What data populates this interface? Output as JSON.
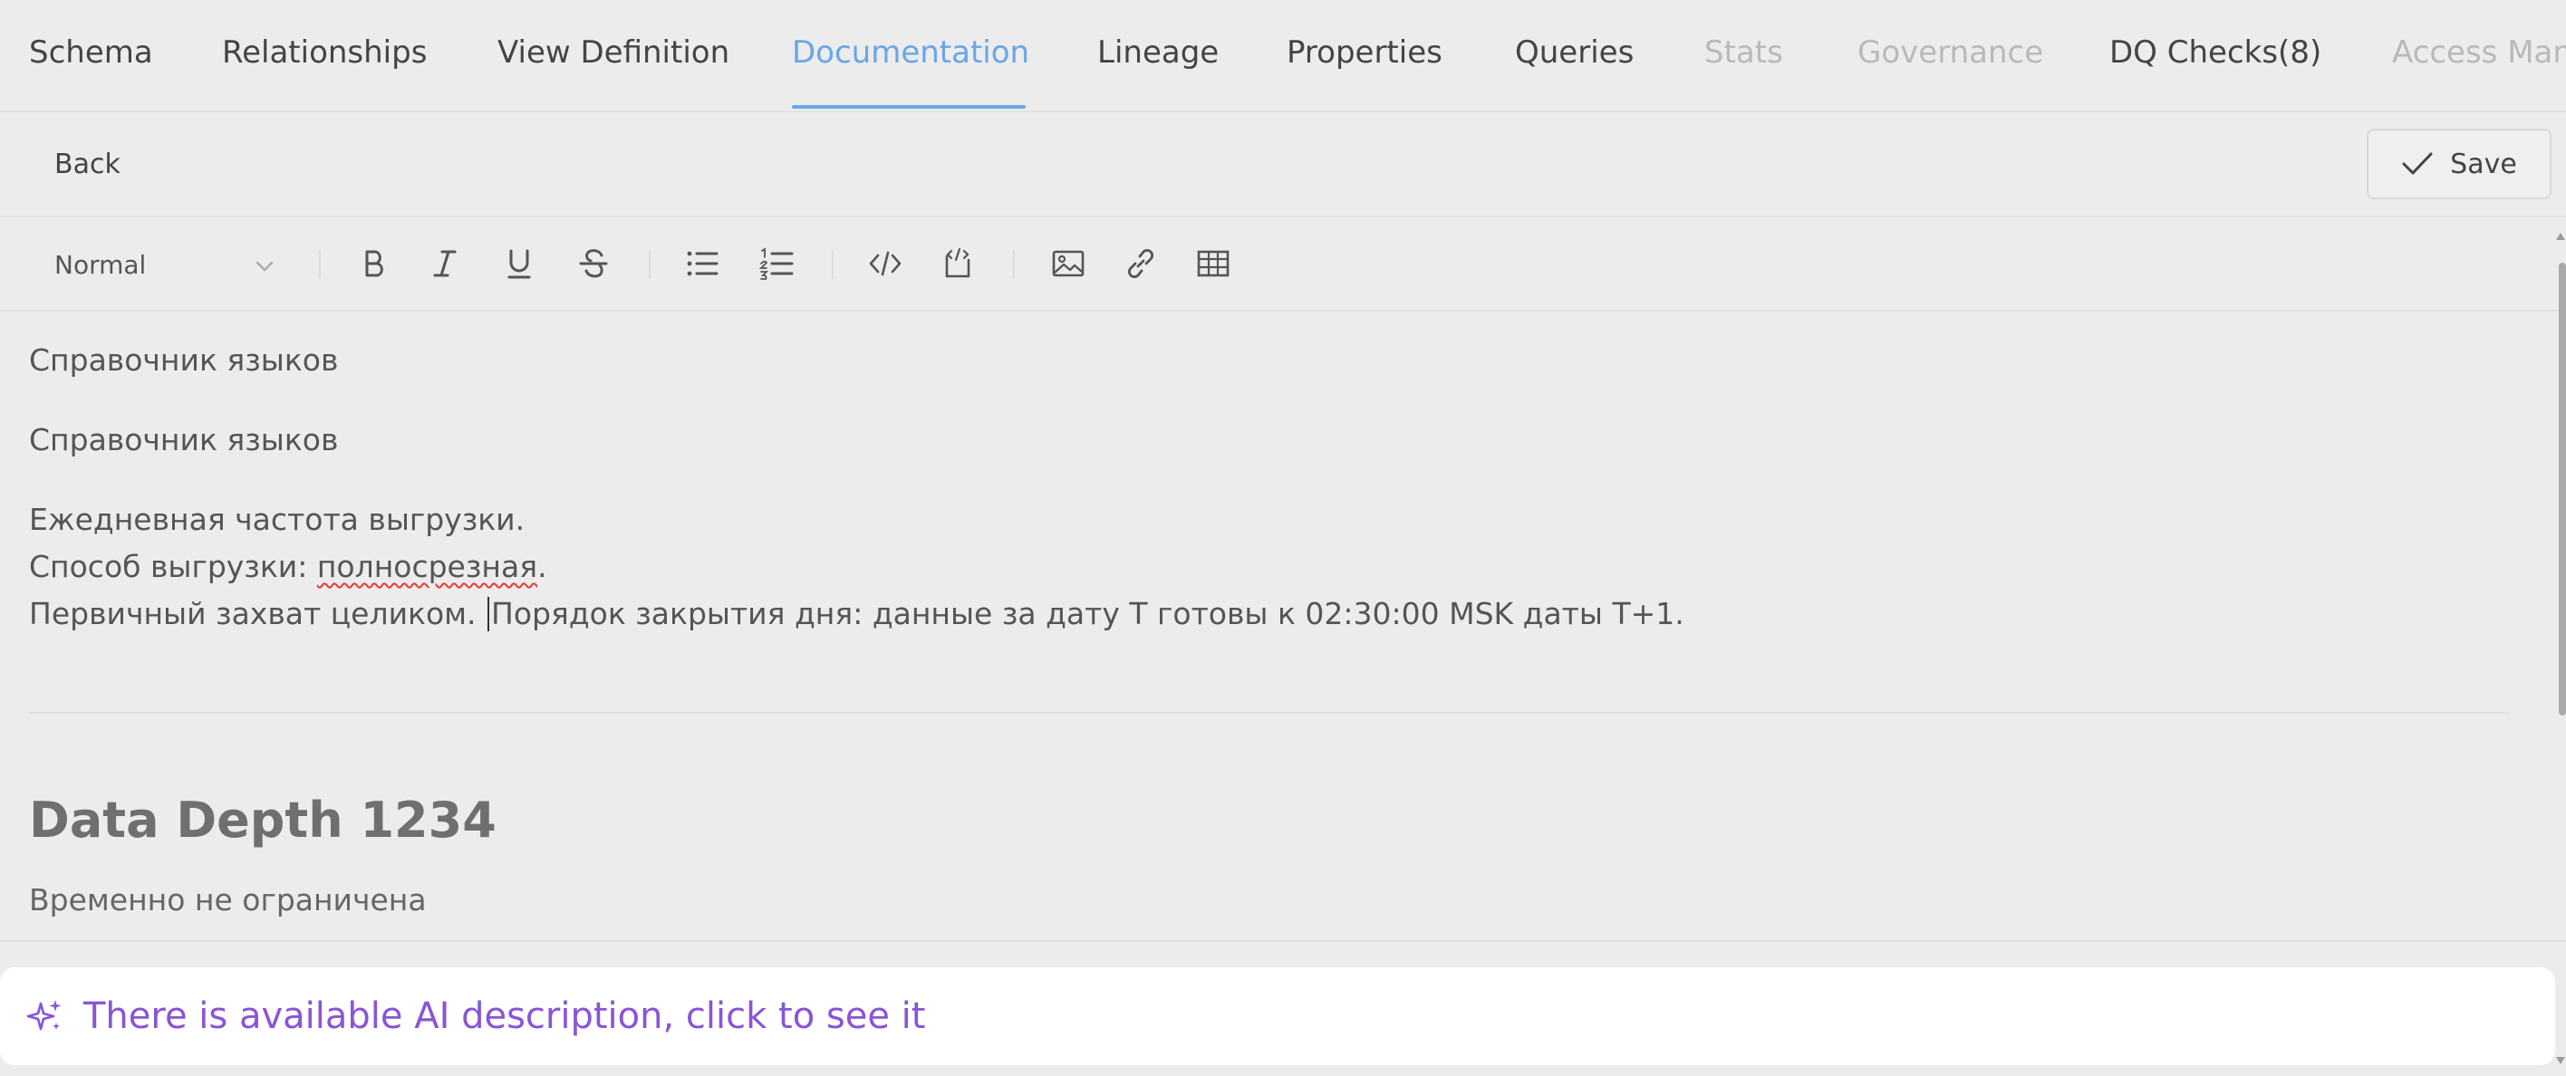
{
  "tabs": [
    {
      "label": "Schema"
    },
    {
      "label": "Relationships"
    },
    {
      "label": "View Definition"
    },
    {
      "label": "Documentation"
    },
    {
      "label": "Lineage"
    },
    {
      "label": "Properties"
    },
    {
      "label": "Queries"
    },
    {
      "label": "Stats"
    },
    {
      "label": "Governance"
    },
    {
      "label": "DQ Checks(8)"
    },
    {
      "label": "Access Man"
    }
  ],
  "actionbar": {
    "back_label": "Back",
    "save_label": "Save"
  },
  "toolbar": {
    "format_value": "Normal",
    "icons": [
      "bold-icon",
      "italic-icon",
      "underline-icon",
      "strikethrough-icon",
      "bullet-list-icon",
      "numbered-list-icon",
      "code-icon",
      "code-block-icon",
      "image-icon",
      "link-icon",
      "table-icon"
    ]
  },
  "editor": {
    "line1": "Справочник языков",
    "line2": "Справочник языков",
    "line3": "Ежедневная частота выгрузки.",
    "line4_prefix": "Способ выгрузки: ",
    "line4_misspelled": "полносрезная",
    "line4_suffix": ".",
    "line5_before_caret": "Первичный захват целиком. ",
    "line5_after_caret": "Порядок закрытия дня: данные за дату T готовы к 02:30:00 MSK даты T+1.",
    "heading": "Data Depth 1234",
    "heading_sub": "Временно не ограничена"
  },
  "ai_banner": {
    "text": "There is available AI description, click to see it"
  },
  "colors": {
    "accent": "#6aa6e6",
    "ai_purple": "#8a54d6",
    "background": "#ececec"
  }
}
